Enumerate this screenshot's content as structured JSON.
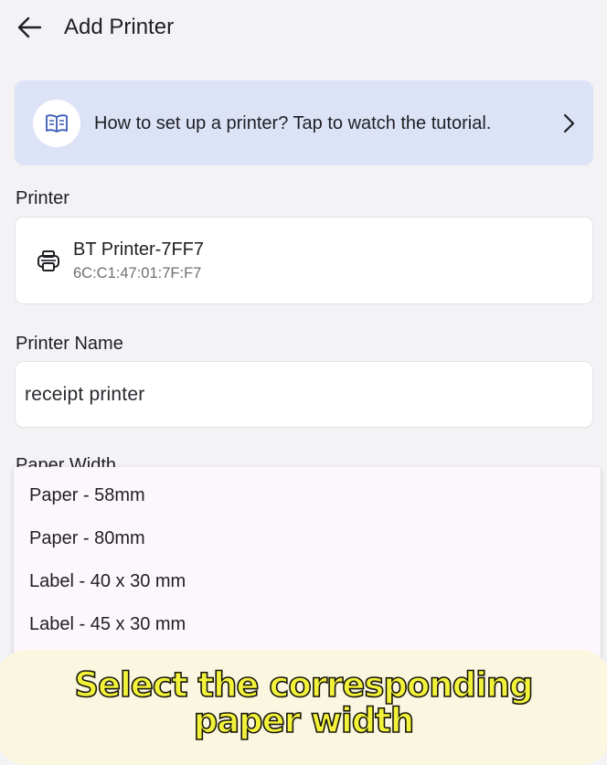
{
  "header": {
    "title": "Add Printer",
    "back_icon": "arrow-left-icon"
  },
  "banner": {
    "text": "How to set up a printer? Tap to watch the tutorial.",
    "icon": "book-open-icon",
    "chevron": "chevron-right-icon",
    "background": "#dde3f7"
  },
  "printer_section": {
    "label": "Printer",
    "device_name": "BT Printer-7FF7",
    "device_address": "6C:C1:47:01:7F:F7",
    "icon": "printer-icon"
  },
  "printer_name_section": {
    "label": "Printer Name",
    "value": "receipt printer"
  },
  "paper_width_section": {
    "label": "Paper Width"
  },
  "dropdown": {
    "options": [
      "Paper - 58mm",
      "Paper - 80mm",
      "Label - 40 x 30 mm",
      "Label - 45 x 30 mm"
    ],
    "background": "#fcf7fd"
  },
  "caption": {
    "line1": "Select the corresponding",
    "line2": "paper width",
    "text_color": "#f3f23a"
  }
}
